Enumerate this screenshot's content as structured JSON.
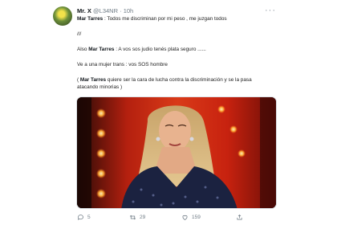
{
  "tweet": {
    "display_name": "Mr. X",
    "handle": "@L34NR",
    "separator": "·",
    "time": "10h",
    "more_icon": "more-dots-icon",
    "lines": {
      "l1_name": "Mar Tarres",
      "l1_text": " : Todos me discriminan por mi peso , me juzgan todos",
      "l2_text": "///",
      "l3_pre": "Also ",
      "l3_name": "Mar Tarres",
      "l3_text": " : A vos sos judio tenés plata seguro ......",
      "l4_text": "Ve a una mujer trans : vos SOS hombre",
      "l5_pre": "( ",
      "l5_name": "Mar Tarres",
      "l5_text": " quiere ser la cara de lucha contra la discriminación y se la pasa",
      "l6_text": "atacando minorias )"
    },
    "actions": {
      "reply_count": "5",
      "retweet_count": "29",
      "like_count": "159",
      "reply_icon": "reply-icon",
      "retweet_icon": "retweet-icon",
      "like_icon": "heart-icon",
      "share_icon": "share-icon"
    },
    "colors": {
      "text": "#0f1419",
      "secondary": "#6f7b85",
      "stage_red": "#d21f12",
      "stage_lights": "#ffb23a"
    }
  }
}
